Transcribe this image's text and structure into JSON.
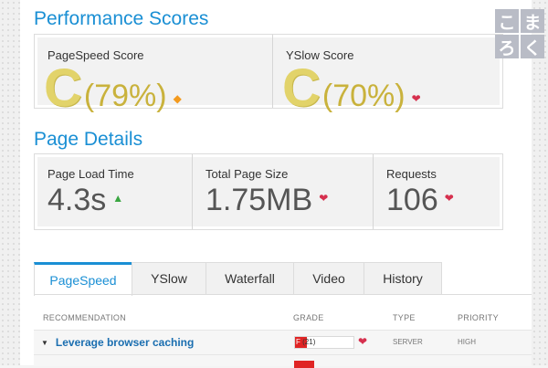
{
  "performance": {
    "title": "Performance Scores",
    "pagespeed": {
      "label": "PageSpeed Score",
      "grade": "C",
      "percent": "(79%)",
      "trend_icon": "diamond-icon"
    },
    "yslow": {
      "label": "YSlow Score",
      "grade": "C",
      "percent": "(70%)",
      "trend_icon": "chevron-down-icon"
    }
  },
  "details": {
    "title": "Page Details",
    "load_time": {
      "label": "Page Load Time",
      "value": "4.3s",
      "trend_icon": "chevron-up-icon"
    },
    "page_size": {
      "label": "Total Page Size",
      "value": "1.75MB",
      "trend_icon": "chevron-down-icon"
    },
    "requests": {
      "label": "Requests",
      "value": "106",
      "trend_icon": "chevron-down-icon"
    }
  },
  "tabs": [
    {
      "label": "PageSpeed",
      "active": true
    },
    {
      "label": "YSlow",
      "active": false
    },
    {
      "label": "Waterfall",
      "active": false
    },
    {
      "label": "Video",
      "active": false
    },
    {
      "label": "History",
      "active": false
    }
  ],
  "table": {
    "headers": {
      "recommendation": "RECOMMENDATION",
      "grade": "GRADE",
      "type": "TYPE",
      "priority": "PRIORITY"
    },
    "rows": [
      {
        "recommendation": "Leverage browser caching",
        "grade_letter": "F",
        "grade_score": "(21)",
        "grade_fraction": 0.21,
        "type": "SERVER",
        "priority": "HIGH"
      }
    ]
  },
  "logo": {
    "chars": [
      "こ",
      "ま",
      "ろ",
      "く"
    ]
  },
  "colors": {
    "accent": "#1a8fd4",
    "grade_c": "#e2d36a",
    "grade_f": "#e02424",
    "up": "#3aa641",
    "down": "#d6304e"
  }
}
